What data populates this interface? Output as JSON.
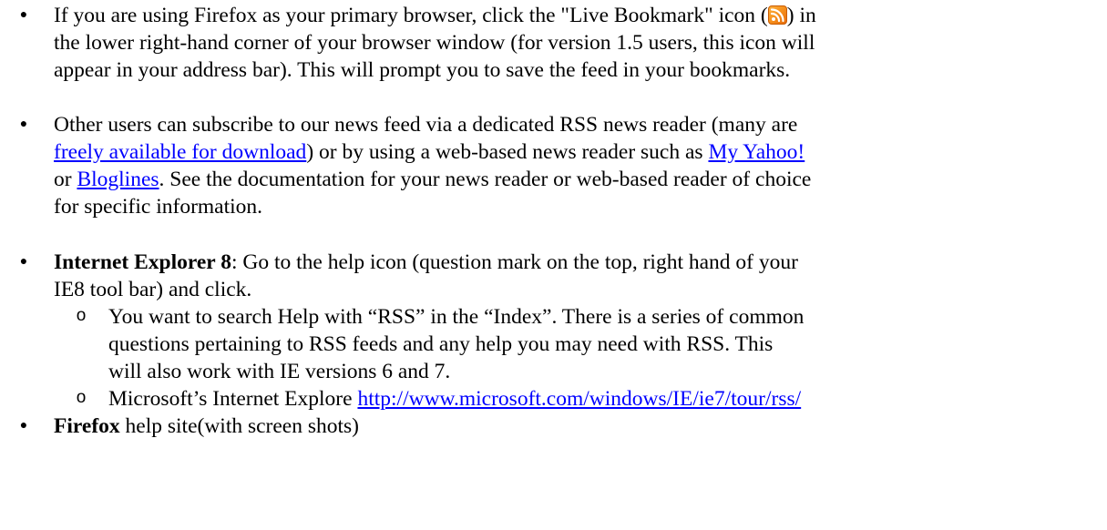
{
  "items": [
    {
      "pre": "If you are using Firefox as your primary browser, click the \"Live Bookmark\" icon (",
      "post_l1": ") in",
      "line2": "the lower right-hand corner of your browser window (for version 1.5 users, this icon will",
      "line3": "appear in your address bar). This will prompt you to save the feed in your bookmarks.",
      "icon": "rss-feed-icon"
    },
    {
      "line1": "Other users can subscribe to our news feed via a dedicated RSS news reader (many are",
      "link1": "freely available for download",
      "mid1": ") or by using a web-based news reader such as ",
      "link2": "My Yahoo!",
      "pre3": "or ",
      "link3": "Bloglines",
      "post3": ". See the documentation for your news reader or web-based reader of choice",
      "line4": "for specific information."
    },
    {
      "bold": "Internet Explorer 8",
      "line1": ":  Go to the help icon (question mark on the top, right hand of your",
      "line2": "IE8 tool bar) and click.",
      "sub": [
        {
          "line1": "You want to search Help with “RSS” in the “Index”.  There is a series of common",
          "line2": "questions pertaining to RSS feeds and any help you may need with RSS.  This",
          "line3": "will also work with IE versions 6 and 7."
        },
        {
          "text": "Microsoft’s Internet Explore ",
          "link": "http://www.microsoft.com/windows/IE/ie7/tour/rss/"
        }
      ]
    },
    {
      "bold": "Firefox",
      "text": " help site(with screen shots)"
    }
  ],
  "colors": {
    "link": "#0000ff",
    "rss_orange": "#f7931e"
  }
}
